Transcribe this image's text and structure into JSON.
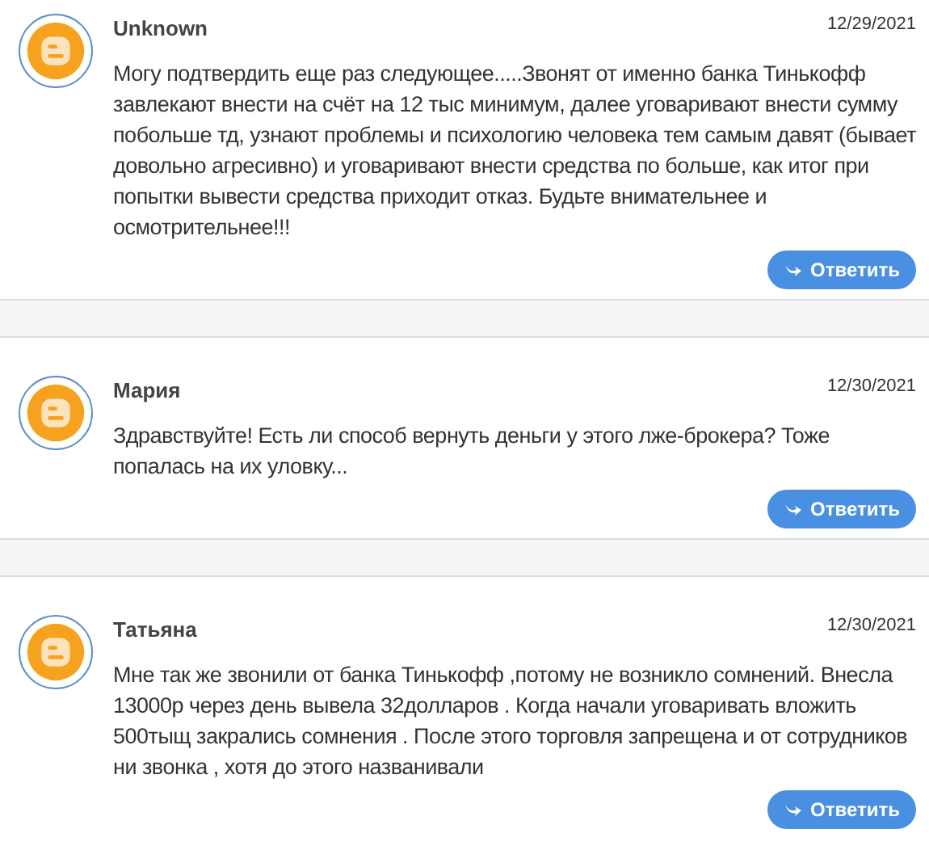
{
  "comments": [
    {
      "author": "Unknown",
      "date": "12/29/2021",
      "text": "Могу подтвердить еще раз следующее.....Звонят от именно банка Тинькофф завлекают внести на счёт на 12 тыс минимум, далее уговаривают внести сумму побольше тд, узнают проблемы и психологию человека тем самым давят (бывает довольно агресивно) и уговаривают внести средства по больше, как итог при попытки вывести средства приходит отказ. Будьте внимательнее и осмотрительнее!!!",
      "reply": "Ответить"
    },
    {
      "author": "Мария",
      "date": "12/30/2021",
      "text": "Здравствуйте! Есть ли способ вернуть деньги у этого лже-брокера? Тоже попалась на их уловку...",
      "reply": "Ответить"
    },
    {
      "author": "Татьяна",
      "date": "12/30/2021",
      "text": "Мне так же звонили от банка Тинькофф ,потому не возникло сомнений. Внесла 13000р через день вывела 32долларов . Когда начали уговаривать вложить 500тыщ закрались сомнения . После этого торговля запрещена и от сотрудников ни звонка , хотя до этого названивали",
      "reply": "Ответить"
    }
  ]
}
